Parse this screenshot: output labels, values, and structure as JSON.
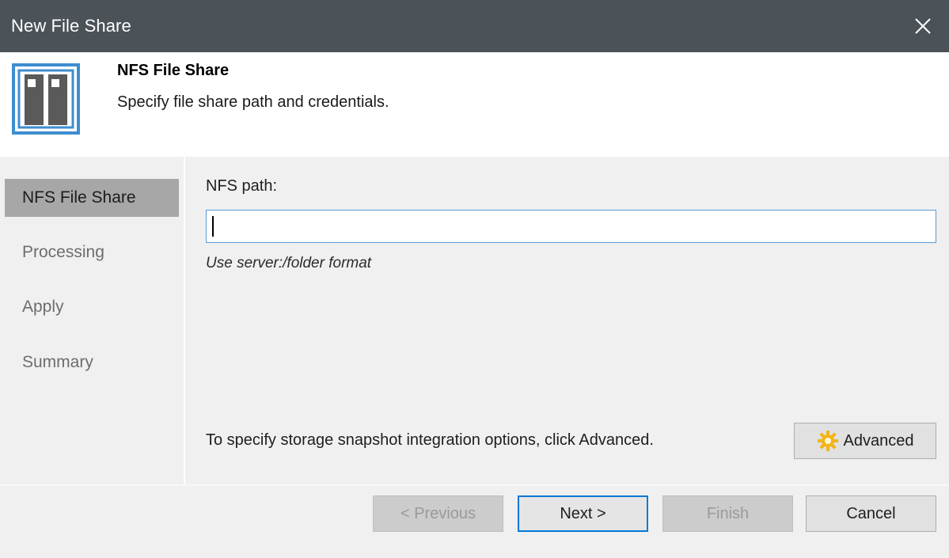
{
  "window": {
    "title": "New File Share",
    "close_icon": "close-icon"
  },
  "header": {
    "title": "NFS File Share",
    "subtitle": "Specify file share path and credentials.",
    "icon": "file-share-icon",
    "accent_color": "#3e8ed0"
  },
  "sidebar": {
    "items": [
      {
        "label": "NFS File Share",
        "active": true
      },
      {
        "label": "Processing",
        "active": false
      },
      {
        "label": "Apply",
        "active": false
      },
      {
        "label": "Summary",
        "active": false
      }
    ]
  },
  "form": {
    "nfs_path_label": "NFS path:",
    "nfs_path_value": "",
    "nfs_path_hint": "Use server:/folder format",
    "advanced_text": "To specify storage snapshot integration options, click Advanced.",
    "advanced_button": "Advanced",
    "advanced_icon": "gear-icon"
  },
  "footer": {
    "previous": "< Previous",
    "next": "Next >",
    "finish": "Finish",
    "cancel": "Cancel"
  }
}
